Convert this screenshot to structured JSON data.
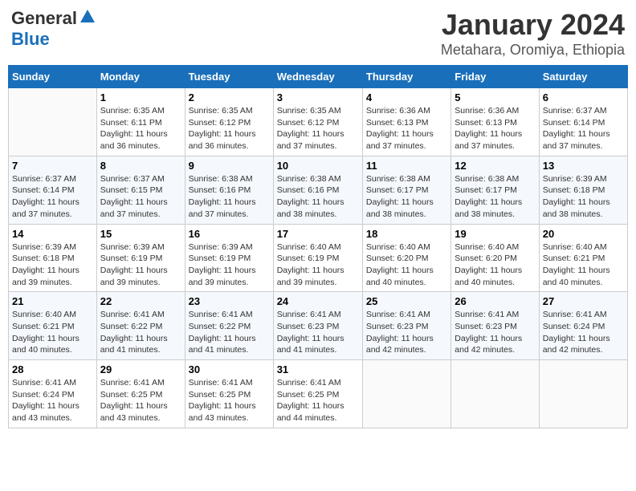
{
  "header": {
    "logo_general": "General",
    "logo_blue": "Blue",
    "title": "January 2024",
    "subtitle": "Metahara, Oromiya, Ethiopia"
  },
  "days_of_week": [
    "Sunday",
    "Monday",
    "Tuesday",
    "Wednesday",
    "Thursday",
    "Friday",
    "Saturday"
  ],
  "weeks": [
    [
      {
        "day": "",
        "info": ""
      },
      {
        "day": "1",
        "info": "Sunrise: 6:35 AM\nSunset: 6:11 PM\nDaylight: 11 hours\nand 36 minutes."
      },
      {
        "day": "2",
        "info": "Sunrise: 6:35 AM\nSunset: 6:12 PM\nDaylight: 11 hours\nand 36 minutes."
      },
      {
        "day": "3",
        "info": "Sunrise: 6:35 AM\nSunset: 6:12 PM\nDaylight: 11 hours\nand 37 minutes."
      },
      {
        "day": "4",
        "info": "Sunrise: 6:36 AM\nSunset: 6:13 PM\nDaylight: 11 hours\nand 37 minutes."
      },
      {
        "day": "5",
        "info": "Sunrise: 6:36 AM\nSunset: 6:13 PM\nDaylight: 11 hours\nand 37 minutes."
      },
      {
        "day": "6",
        "info": "Sunrise: 6:37 AM\nSunset: 6:14 PM\nDaylight: 11 hours\nand 37 minutes."
      }
    ],
    [
      {
        "day": "7",
        "info": "Sunrise: 6:37 AM\nSunset: 6:14 PM\nDaylight: 11 hours\nand 37 minutes."
      },
      {
        "day": "8",
        "info": "Sunrise: 6:37 AM\nSunset: 6:15 PM\nDaylight: 11 hours\nand 37 minutes."
      },
      {
        "day": "9",
        "info": "Sunrise: 6:38 AM\nSunset: 6:16 PM\nDaylight: 11 hours\nand 37 minutes."
      },
      {
        "day": "10",
        "info": "Sunrise: 6:38 AM\nSunset: 6:16 PM\nDaylight: 11 hours\nand 38 minutes."
      },
      {
        "day": "11",
        "info": "Sunrise: 6:38 AM\nSunset: 6:17 PM\nDaylight: 11 hours\nand 38 minutes."
      },
      {
        "day": "12",
        "info": "Sunrise: 6:38 AM\nSunset: 6:17 PM\nDaylight: 11 hours\nand 38 minutes."
      },
      {
        "day": "13",
        "info": "Sunrise: 6:39 AM\nSunset: 6:18 PM\nDaylight: 11 hours\nand 38 minutes."
      }
    ],
    [
      {
        "day": "14",
        "info": "Sunrise: 6:39 AM\nSunset: 6:18 PM\nDaylight: 11 hours\nand 39 minutes."
      },
      {
        "day": "15",
        "info": "Sunrise: 6:39 AM\nSunset: 6:19 PM\nDaylight: 11 hours\nand 39 minutes."
      },
      {
        "day": "16",
        "info": "Sunrise: 6:39 AM\nSunset: 6:19 PM\nDaylight: 11 hours\nand 39 minutes."
      },
      {
        "day": "17",
        "info": "Sunrise: 6:40 AM\nSunset: 6:19 PM\nDaylight: 11 hours\nand 39 minutes."
      },
      {
        "day": "18",
        "info": "Sunrise: 6:40 AM\nSunset: 6:20 PM\nDaylight: 11 hours\nand 40 minutes."
      },
      {
        "day": "19",
        "info": "Sunrise: 6:40 AM\nSunset: 6:20 PM\nDaylight: 11 hours\nand 40 minutes."
      },
      {
        "day": "20",
        "info": "Sunrise: 6:40 AM\nSunset: 6:21 PM\nDaylight: 11 hours\nand 40 minutes."
      }
    ],
    [
      {
        "day": "21",
        "info": "Sunrise: 6:40 AM\nSunset: 6:21 PM\nDaylight: 11 hours\nand 40 minutes."
      },
      {
        "day": "22",
        "info": "Sunrise: 6:41 AM\nSunset: 6:22 PM\nDaylight: 11 hours\nand 41 minutes."
      },
      {
        "day": "23",
        "info": "Sunrise: 6:41 AM\nSunset: 6:22 PM\nDaylight: 11 hours\nand 41 minutes."
      },
      {
        "day": "24",
        "info": "Sunrise: 6:41 AM\nSunset: 6:23 PM\nDaylight: 11 hours\nand 41 minutes."
      },
      {
        "day": "25",
        "info": "Sunrise: 6:41 AM\nSunset: 6:23 PM\nDaylight: 11 hours\nand 42 minutes."
      },
      {
        "day": "26",
        "info": "Sunrise: 6:41 AM\nSunset: 6:23 PM\nDaylight: 11 hours\nand 42 minutes."
      },
      {
        "day": "27",
        "info": "Sunrise: 6:41 AM\nSunset: 6:24 PM\nDaylight: 11 hours\nand 42 minutes."
      }
    ],
    [
      {
        "day": "28",
        "info": "Sunrise: 6:41 AM\nSunset: 6:24 PM\nDaylight: 11 hours\nand 43 minutes."
      },
      {
        "day": "29",
        "info": "Sunrise: 6:41 AM\nSunset: 6:25 PM\nDaylight: 11 hours\nand 43 minutes."
      },
      {
        "day": "30",
        "info": "Sunrise: 6:41 AM\nSunset: 6:25 PM\nDaylight: 11 hours\nand 43 minutes."
      },
      {
        "day": "31",
        "info": "Sunrise: 6:41 AM\nSunset: 6:25 PM\nDaylight: 11 hours\nand 44 minutes."
      },
      {
        "day": "",
        "info": ""
      },
      {
        "day": "",
        "info": ""
      },
      {
        "day": "",
        "info": ""
      }
    ]
  ]
}
